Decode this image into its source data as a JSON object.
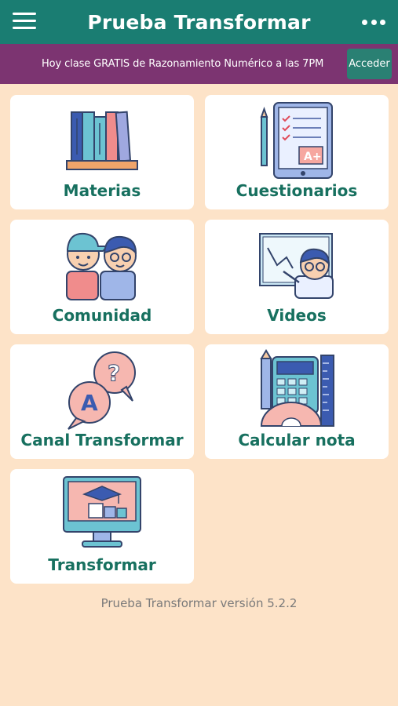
{
  "appbar": {
    "title": "Prueba Transformar",
    "menu_icon": "hamburger-menu-icon",
    "more_icon": "more-options-icon"
  },
  "banner": {
    "text": "Hoy clase GRATIS de Razonamiento Numérico a las 7PM",
    "button_label": "Acceder"
  },
  "menu": {
    "items": [
      {
        "label": "Materias",
        "icon": "bookshelf-icon"
      },
      {
        "label": "Cuestionarios",
        "icon": "quiz-tablet-icon"
      },
      {
        "label": "Comunidad",
        "icon": "students-icon"
      },
      {
        "label": "Videos",
        "icon": "teacher-board-icon"
      },
      {
        "label": "Canal Transformar",
        "icon": "chat-bubbles-icon"
      },
      {
        "label": "Calcular nota",
        "icon": "calculator-tools-icon"
      },
      {
        "label": "Transformar",
        "icon": "computer-education-icon"
      }
    ]
  },
  "footer": {
    "version": "Prueba Transformar versión 5.2.2"
  },
  "colors": {
    "appbar": "#1a7d72",
    "banner": "#7c3471",
    "background": "#fde3c8",
    "label": "#17705f"
  }
}
